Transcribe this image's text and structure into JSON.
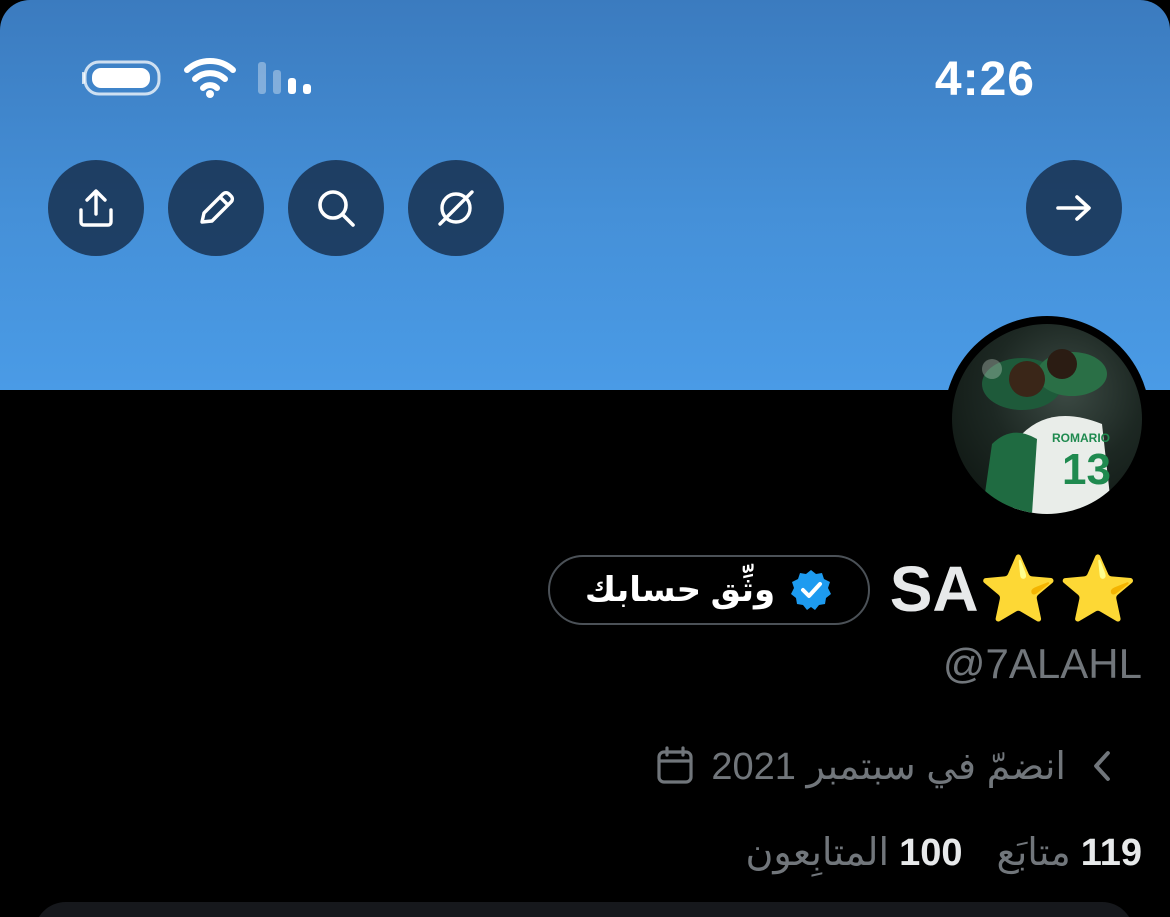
{
  "status_bar": {
    "time": "4:26"
  },
  "toolbar": {
    "share_icon": "share-icon",
    "edit_icon": "pencil-icon",
    "search_icon": "search-icon",
    "slash_icon": "slash-circle-icon",
    "forward_icon": "arrow-right-icon"
  },
  "profile": {
    "display_name": "SA⭐⭐",
    "handle": "@7ALAHL",
    "verify_label": "وثِّق حسابك",
    "joined": "انضمّ في سبتمبر 2021",
    "following_count": "119",
    "following_label": "متابَع",
    "followers_count": "100",
    "followers_label": "المتابِعون"
  },
  "colors": {
    "banner_top": "#3b7bbf",
    "banner_bottom": "#4a9be6",
    "button_bg": "#162d4b",
    "verified_blue": "#1d9bf0",
    "muted_text": "#71767b"
  }
}
